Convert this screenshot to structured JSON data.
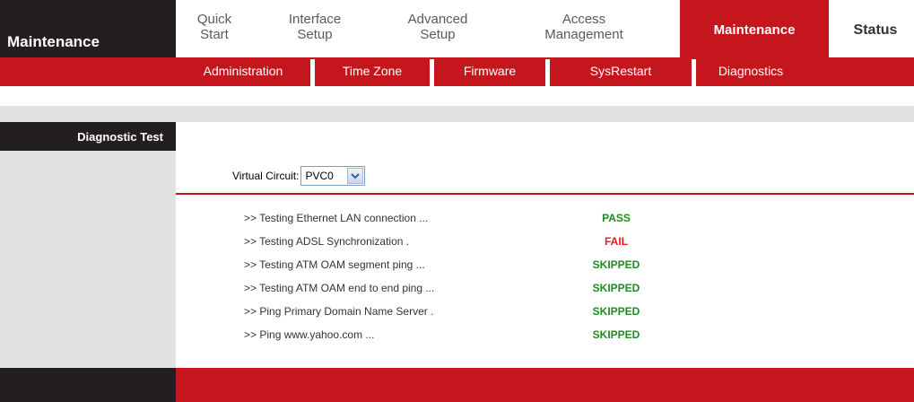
{
  "brand": {
    "title": "Maintenance"
  },
  "top_nav": [
    {
      "line1": "Quick",
      "line2": "Start"
    },
    {
      "line1": "Interface",
      "line2": "Setup"
    },
    {
      "line1": "Advanced",
      "line2": "Setup"
    },
    {
      "line1": "Access",
      "line2": "Management"
    },
    {
      "line1": "Maintenance",
      "line2": ""
    },
    {
      "line1": "Status",
      "line2": ""
    }
  ],
  "top_nav_active": "Maintenance",
  "sub_nav": [
    "Administration",
    "Time Zone",
    "Firmware",
    "SysRestart",
    "Diagnostics"
  ],
  "section": {
    "title": "Diagnostic Test"
  },
  "virtual_circuit": {
    "label": "Virtual Circuit:",
    "selected": "PVC0"
  },
  "tests": [
    {
      "label": ">> Testing Ethernet LAN connection ...",
      "status": "PASS"
    },
    {
      "label": ">> Testing ADSL Synchronization .",
      "status": "FAIL"
    },
    {
      "label": ">> Testing ATM OAM segment ping ...",
      "status": "SKIPPED"
    },
    {
      "label": ">> Testing ATM OAM end to end ping ...",
      "status": "SKIPPED"
    },
    {
      "label": ">> Ping Primary Domain Name Server .",
      "status": "SKIPPED"
    },
    {
      "label": ">> Ping www.yahoo.com ...",
      "status": "SKIPPED"
    }
  ],
  "colors": {
    "accent_red": "#c4161c",
    "dark": "#231f20",
    "pass_green": "#1e8c1e",
    "fail_red": "#e31b1b"
  },
  "icons": {
    "select_arrow": "chevron-down-icon"
  }
}
